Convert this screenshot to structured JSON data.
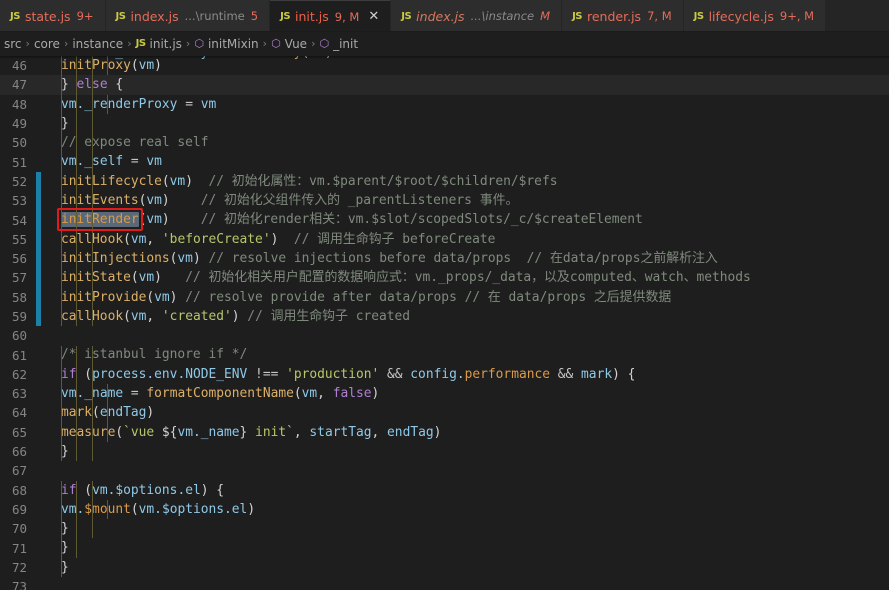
{
  "tabs": [
    {
      "icon": "js-file-icon",
      "name": "state.js",
      "desc": "",
      "badge": "9+",
      "active": false,
      "italic": false,
      "closable": false
    },
    {
      "icon": "js-file-icon",
      "name": "index.js",
      "desc": "...\\runtime",
      "badge": "5",
      "active": false,
      "italic": false,
      "closable": false
    },
    {
      "icon": "js-file-icon",
      "name": "init.js",
      "desc": "",
      "badge": "9, M",
      "active": true,
      "italic": false,
      "closable": true,
      "close_glyph": "✕"
    },
    {
      "icon": "js-file-icon",
      "name": "index.js",
      "desc": "...\\instance",
      "badge": "M",
      "active": false,
      "italic": true,
      "closable": false
    },
    {
      "icon": "js-file-icon",
      "name": "render.js",
      "desc": "",
      "badge": "7, M",
      "active": false,
      "italic": false,
      "closable": false
    },
    {
      "icon": "js-file-icon",
      "name": "lifecycle.js",
      "desc": "",
      "badge": "9+, M",
      "active": false,
      "italic": false,
      "closable": false
    }
  ],
  "tab_icon_label": "JS",
  "breadcrumb": {
    "separator": "›",
    "items": [
      {
        "label": "src",
        "icon": ""
      },
      {
        "label": "core",
        "icon": ""
      },
      {
        "label": "instance",
        "icon": ""
      },
      {
        "label": "init.js",
        "icon": "js-file-icon"
      },
      {
        "label": "initMixin",
        "icon": "symbol-method-icon"
      },
      {
        "label": "Vue",
        "icon": "symbol-method-icon"
      },
      {
        "label": "_init",
        "icon": "symbol-method-icon"
      }
    ]
  },
  "editor": {
    "first_line_number": 46,
    "current_line": 47,
    "selection": {
      "line": 54,
      "text": "initRender"
    },
    "annotation": {
      "shape": "rectangle",
      "color": "#e01b1b",
      "target": "initRender"
    },
    "git_modified_lines": [
      52,
      53,
      54,
      55,
      56,
      57,
      58,
      59
    ],
    "lines": [
      {
        "n": 46,
        "tokens": [
          {
            "t": "fn",
            "v": "initProxy"
          },
          {
            "t": "punc",
            "v": "("
          },
          {
            "t": "var",
            "v": "vm"
          },
          {
            "t": "punc",
            "v": ")"
          }
        ],
        "indent": 4
      },
      {
        "n": 47,
        "tokens": [
          {
            "t": "punc",
            "v": "} "
          },
          {
            "t": "kw",
            "v": "else"
          },
          {
            "t": "punc",
            "v": " {"
          }
        ],
        "indent": 3
      },
      {
        "n": 48,
        "tokens": [
          {
            "t": "var",
            "v": "vm."
          },
          {
            "t": "prop",
            "v": "_renderProxy"
          },
          {
            "t": "op",
            "v": " = "
          },
          {
            "t": "var",
            "v": "vm"
          }
        ],
        "indent": 4
      },
      {
        "n": 49,
        "tokens": [
          {
            "t": "punc",
            "v": "}"
          }
        ],
        "indent": 3
      },
      {
        "n": 50,
        "tokens": [
          {
            "t": "cmt",
            "v": "// expose real self"
          }
        ],
        "indent": 3
      },
      {
        "n": 51,
        "tokens": [
          {
            "t": "var",
            "v": "vm."
          },
          {
            "t": "prop",
            "v": "_self"
          },
          {
            "t": "op",
            "v": " = "
          },
          {
            "t": "var",
            "v": "vm"
          }
        ],
        "indent": 3
      },
      {
        "n": 52,
        "tokens": [
          {
            "t": "fn",
            "v": "initLifecycle"
          },
          {
            "t": "punc",
            "v": "("
          },
          {
            "t": "var",
            "v": "vm"
          },
          {
            "t": "punc",
            "v": ")"
          },
          {
            "t": "cmt",
            "v": "  // 初始化属性：vm.$parent/$root/$children/$refs"
          }
        ],
        "indent": 3
      },
      {
        "n": 53,
        "tokens": [
          {
            "t": "fn",
            "v": "initEvents"
          },
          {
            "t": "punc",
            "v": "("
          },
          {
            "t": "var",
            "v": "vm"
          },
          {
            "t": "punc",
            "v": ")"
          },
          {
            "t": "cmt",
            "v": "    // 初始化父组件传入的 _parentListeners 事件。"
          }
        ],
        "indent": 3
      },
      {
        "n": 54,
        "tokens": [
          {
            "t": "sel",
            "v": "initRender"
          },
          {
            "t": "punc",
            "v": "("
          },
          {
            "t": "var",
            "v": "vm"
          },
          {
            "t": "punc",
            "v": ")"
          },
          {
            "t": "cmt",
            "v": "    // 初始化render相关：vm.$slot/scopedSlots/_c/$createElement"
          }
        ],
        "indent": 3
      },
      {
        "n": 55,
        "tokens": [
          {
            "t": "fn",
            "v": "callHook"
          },
          {
            "t": "punc",
            "v": "("
          },
          {
            "t": "var",
            "v": "vm"
          },
          {
            "t": "punc",
            "v": ", "
          },
          {
            "t": "str",
            "v": "'beforeCreate'"
          },
          {
            "t": "punc",
            "v": ")"
          },
          {
            "t": "cmt",
            "v": "  // 调用生命钩子 beforeCreate"
          }
        ],
        "indent": 3
      },
      {
        "n": 56,
        "tokens": [
          {
            "t": "fn",
            "v": "initInjections"
          },
          {
            "t": "punc",
            "v": "("
          },
          {
            "t": "var",
            "v": "vm"
          },
          {
            "t": "punc",
            "v": ")"
          },
          {
            "t": "cmt",
            "v": " // resolve injections before data/props  // 在data/props之前解析注入"
          }
        ],
        "indent": 3
      },
      {
        "n": 57,
        "tokens": [
          {
            "t": "fn",
            "v": "initState"
          },
          {
            "t": "punc",
            "v": "("
          },
          {
            "t": "var",
            "v": "vm"
          },
          {
            "t": "punc",
            "v": ")"
          },
          {
            "t": "cmt",
            "v": "   // 初始化相关用户配置的数据响应式：vm._props/_data，以及computed、watch、methods"
          }
        ],
        "indent": 3
      },
      {
        "n": 58,
        "tokens": [
          {
            "t": "fn",
            "v": "initProvide"
          },
          {
            "t": "punc",
            "v": "("
          },
          {
            "t": "var",
            "v": "vm"
          },
          {
            "t": "punc",
            "v": ")"
          },
          {
            "t": "cmt",
            "v": " // resolve provide after data/props // 在 data/props 之后提供数据"
          }
        ],
        "indent": 3
      },
      {
        "n": 59,
        "tokens": [
          {
            "t": "fn",
            "v": "callHook"
          },
          {
            "t": "punc",
            "v": "("
          },
          {
            "t": "var",
            "v": "vm"
          },
          {
            "t": "punc",
            "v": ", "
          },
          {
            "t": "str",
            "v": "'created'"
          },
          {
            "t": "punc",
            "v": ")"
          },
          {
            "t": "cmt",
            "v": " // 调用生命钩子 created"
          }
        ],
        "indent": 3
      },
      {
        "n": 60,
        "tokens": [],
        "indent": 0
      },
      {
        "n": 61,
        "tokens": [
          {
            "t": "cmt",
            "v": "/* istanbul ignore if */"
          }
        ],
        "indent": 3
      },
      {
        "n": 62,
        "tokens": [
          {
            "t": "kw",
            "v": "if"
          },
          {
            "t": "punc",
            "v": " ("
          },
          {
            "t": "var",
            "v": "process."
          },
          {
            "t": "prop",
            "v": "env."
          },
          {
            "t": "prop",
            "v": "NODE_ENV"
          },
          {
            "t": "op",
            "v": " !== "
          },
          {
            "t": "str",
            "v": "'production'"
          },
          {
            "t": "op",
            "v": " && "
          },
          {
            "t": "var",
            "v": "config."
          },
          {
            "t": "fn2",
            "v": "performance"
          },
          {
            "t": "op",
            "v": " && "
          },
          {
            "t": "var",
            "v": "mark"
          },
          {
            "t": "punc",
            "v": ") {"
          }
        ],
        "indent": 3
      },
      {
        "n": 63,
        "tokens": [
          {
            "t": "var",
            "v": "vm."
          },
          {
            "t": "prop",
            "v": "_name"
          },
          {
            "t": "op",
            "v": " = "
          },
          {
            "t": "fn",
            "v": "formatComponentName"
          },
          {
            "t": "punc",
            "v": "("
          },
          {
            "t": "var",
            "v": "vm"
          },
          {
            "t": "punc",
            "v": ", "
          },
          {
            "t": "kw",
            "v": "false"
          },
          {
            "t": "punc",
            "v": ")"
          }
        ],
        "indent": 4
      },
      {
        "n": 64,
        "tokens": [
          {
            "t": "fn",
            "v": "mark"
          },
          {
            "t": "punc",
            "v": "("
          },
          {
            "t": "var",
            "v": "endTag"
          },
          {
            "t": "punc",
            "v": ")"
          }
        ],
        "indent": 4
      },
      {
        "n": 65,
        "tokens": [
          {
            "t": "fn",
            "v": "measure"
          },
          {
            "t": "punc",
            "v": "("
          },
          {
            "t": "tmpl",
            "v": "`vue "
          },
          {
            "t": "punc",
            "v": "${"
          },
          {
            "t": "var",
            "v": "vm."
          },
          {
            "t": "prop",
            "v": "_name"
          },
          {
            "t": "punc",
            "v": "}"
          },
          {
            "t": "tmpl",
            "v": " init`"
          },
          {
            "t": "punc",
            "v": ", "
          },
          {
            "t": "var",
            "v": "startTag"
          },
          {
            "t": "punc",
            "v": ", "
          },
          {
            "t": "var",
            "v": "endTag"
          },
          {
            "t": "punc",
            "v": ")"
          }
        ],
        "indent": 4
      },
      {
        "n": 66,
        "tokens": [
          {
            "t": "punc",
            "v": "}"
          }
        ],
        "indent": 3
      },
      {
        "n": 67,
        "tokens": [],
        "indent": 0
      },
      {
        "n": 68,
        "tokens": [
          {
            "t": "kw",
            "v": "if"
          },
          {
            "t": "punc",
            "v": " ("
          },
          {
            "t": "var",
            "v": "vm."
          },
          {
            "t": "prop",
            "v": "$options."
          },
          {
            "t": "prop",
            "v": "el"
          },
          {
            "t": "punc",
            "v": ") {"
          }
        ],
        "indent": 3
      },
      {
        "n": 69,
        "tokens": [
          {
            "t": "var",
            "v": "vm."
          },
          {
            "t": "fn2",
            "v": "$mount"
          },
          {
            "t": "punc",
            "v": "("
          },
          {
            "t": "var",
            "v": "vm."
          },
          {
            "t": "prop",
            "v": "$options."
          },
          {
            "t": "prop",
            "v": "el"
          },
          {
            "t": "punc",
            "v": ")"
          }
        ],
        "indent": 4
      },
      {
        "n": 70,
        "tokens": [
          {
            "t": "punc",
            "v": "}"
          }
        ],
        "indent": 3
      },
      {
        "n": 71,
        "tokens": [
          {
            "t": "punc",
            "v": "}"
          }
        ],
        "indent": 2
      },
      {
        "n": 72,
        "tokens": [
          {
            "t": "punc",
            "v": "}"
          }
        ],
        "indent": 1
      },
      {
        "n": 73,
        "tokens": [],
        "indent": 0
      }
    ]
  },
  "colors": {
    "editor_bg": "#1e1e1e",
    "tabbar_bg": "#252526",
    "tab_inactive_bg": "#2d2d2d",
    "git_modified": "#1b81a8",
    "annotation_red": "#e01b1b",
    "selection": "#5b6877",
    "indent_guide": "#5f5a32",
    "line_number": "#858585"
  }
}
